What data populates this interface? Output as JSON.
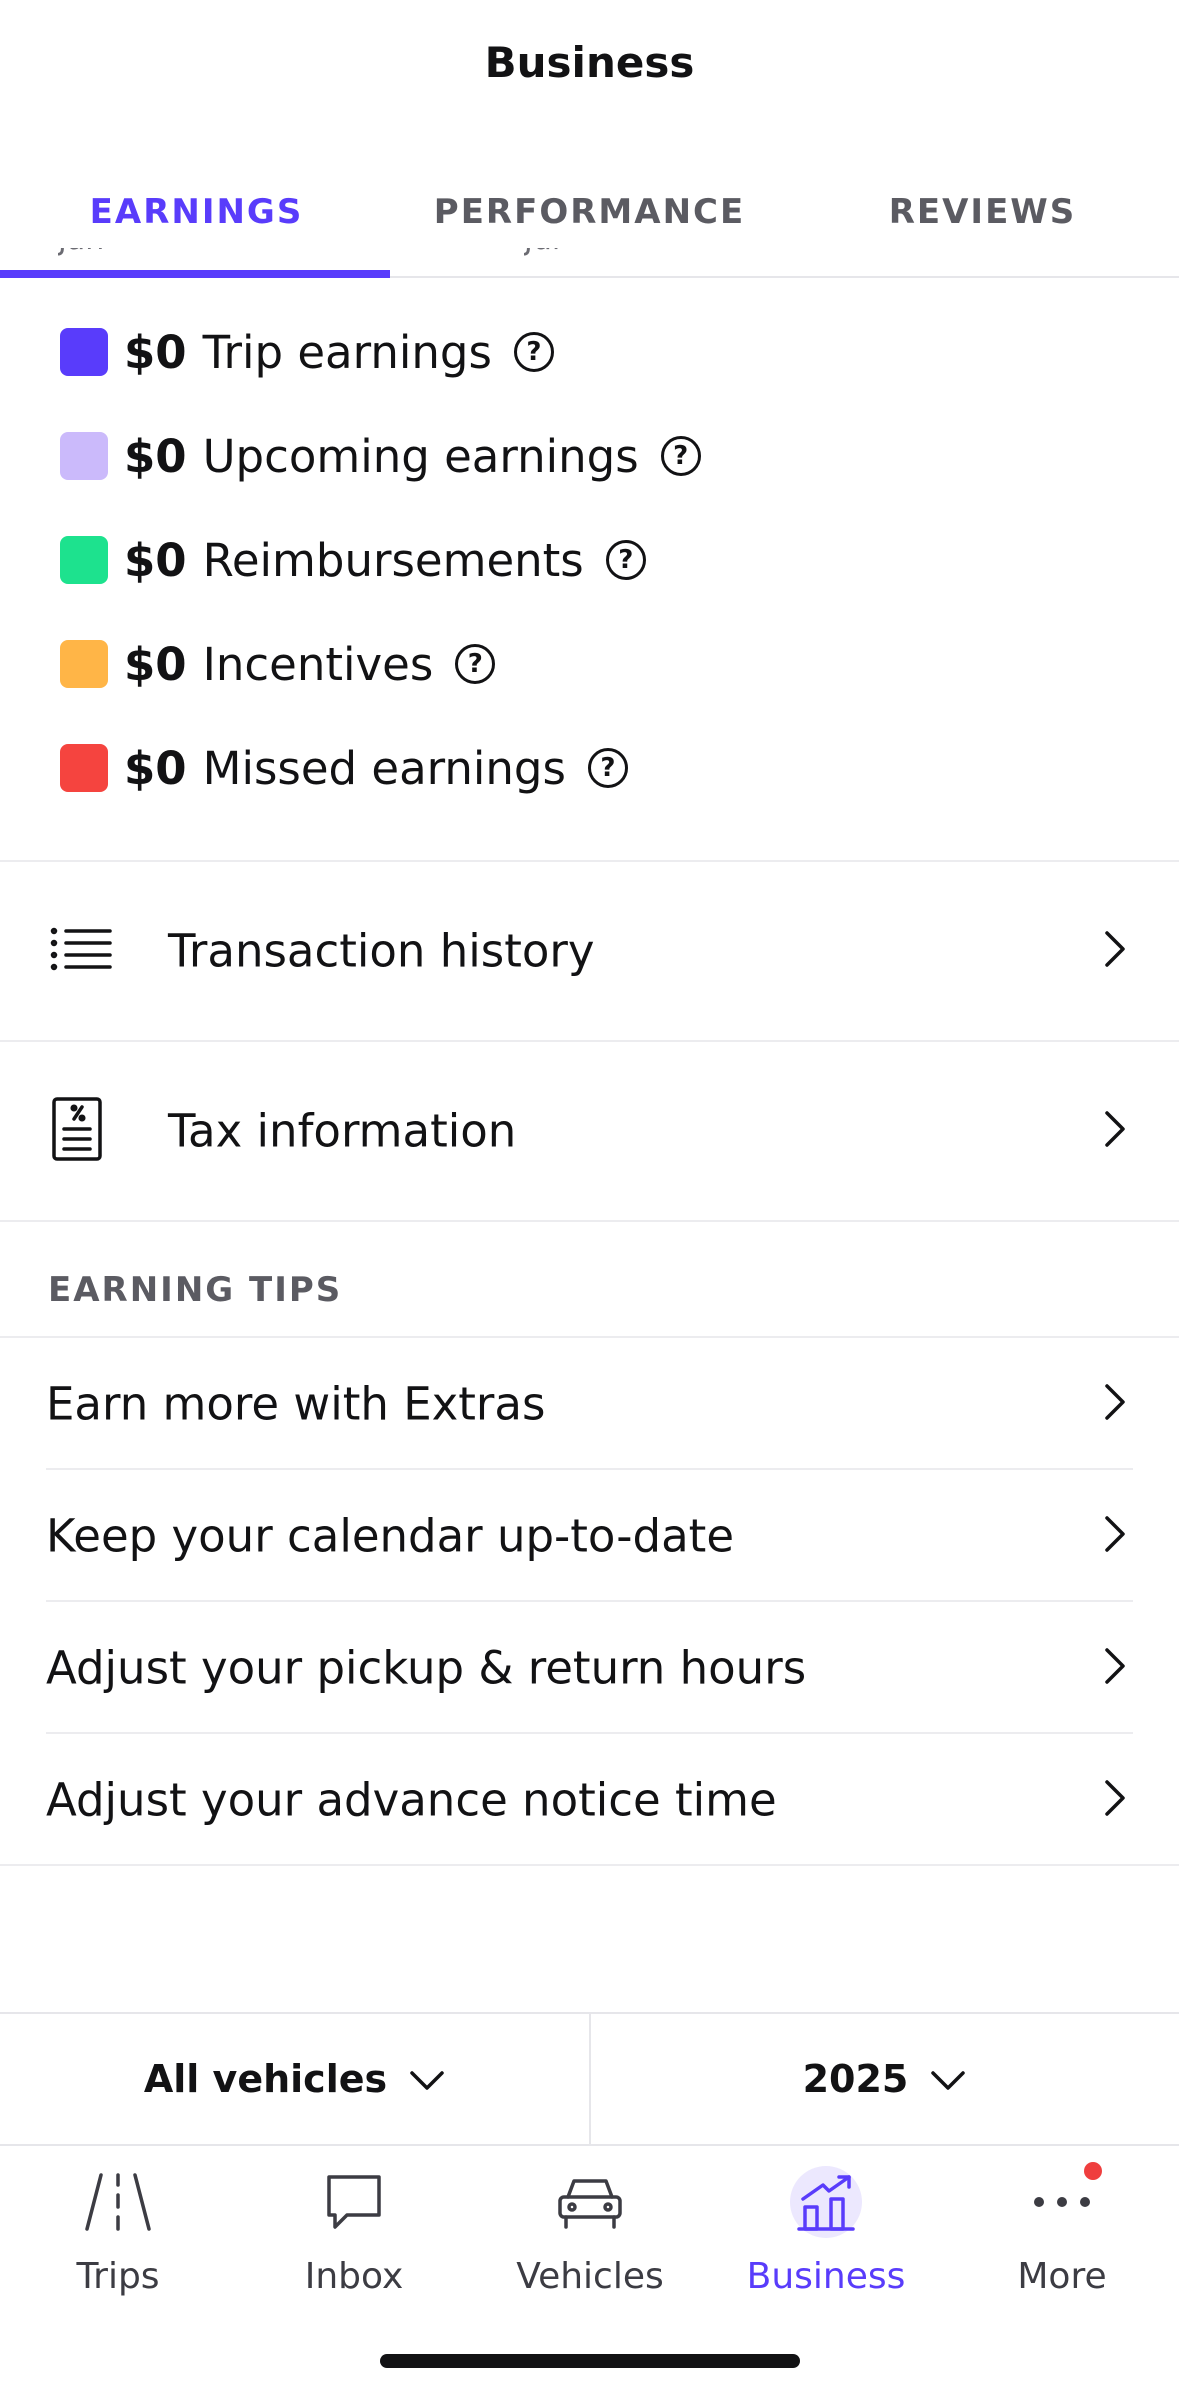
{
  "header": {
    "title": "Business"
  },
  "tabs": [
    {
      "label": "EARNINGS",
      "active": true
    },
    {
      "label": "PERFORMANCE",
      "active": false
    },
    {
      "label": "REVIEWS",
      "active": false
    }
  ],
  "chart_axis_peek": [
    "Jan",
    "Jul"
  ],
  "legend": [
    {
      "amount": "$0",
      "label": "Trip earnings",
      "color": "#593cfb"
    },
    {
      "amount": "$0",
      "label": "Upcoming earnings",
      "color": "#cbbafb"
    },
    {
      "amount": "$0",
      "label": "Reimbursements",
      "color": "#1de28e"
    },
    {
      "amount": "$0",
      "label": "Incentives",
      "color": "#ffb547"
    },
    {
      "amount": "$0",
      "label": "Missed earnings",
      "color": "#f5443f"
    }
  ],
  "rows": {
    "transaction_history": "Transaction history",
    "tax_information": "Tax information"
  },
  "earning_tips": {
    "header": "EARNING TIPS",
    "items": [
      "Earn more with Extras",
      "Keep your calendar up-to-date",
      "Adjust your pickup & return hours",
      "Adjust your advance notice time"
    ]
  },
  "filters": {
    "vehicles": "All vehicles",
    "year": "2025"
  },
  "bottom_nav": [
    {
      "label": "Trips",
      "icon": "road-icon"
    },
    {
      "label": "Inbox",
      "icon": "chat-bubble-icon"
    },
    {
      "label": "Vehicles",
      "icon": "car-icon"
    },
    {
      "label": "Business",
      "icon": "chart-up-icon",
      "active": true
    },
    {
      "label": "More",
      "icon": "more-dots-icon",
      "badge": true
    }
  ],
  "colors": {
    "accent": "#593cfb",
    "badge": "#ef3e3e"
  }
}
